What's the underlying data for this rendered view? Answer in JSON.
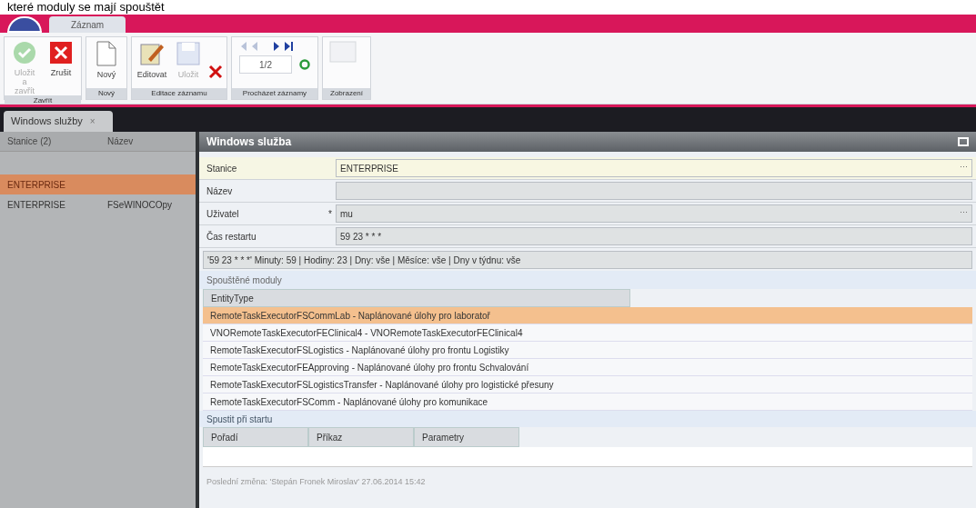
{
  "caption": "které moduly se mají spouštět",
  "ribbon": {
    "tabs": [
      {
        "label": "Záznam",
        "selected": true
      }
    ],
    "groups": [
      {
        "label": "Zavřít",
        "buttons": [
          {
            "kind": "ok",
            "label": "Uložit a zavřít",
            "disabled": true
          },
          {
            "kind": "cancel",
            "label": "Zrušit",
            "disabled": false
          }
        ]
      },
      {
        "label": "Nový",
        "buttons": [
          {
            "kind": "new",
            "label": "Nový",
            "disabled": false
          }
        ]
      },
      {
        "label": "Editace záznamu",
        "buttons": [
          {
            "kind": "edit",
            "label": "Editovat",
            "disabled": false
          },
          {
            "kind": "save",
            "label": "Uložit",
            "disabled": true
          },
          {
            "kind": "delete",
            "disabled": false
          }
        ]
      },
      {
        "label": "Procházet záznamy",
        "buttons": [
          {
            "kind": "pager",
            "label": "1/2",
            "disabled": false
          }
        ]
      },
      {
        "label": "Zobrazení",
        "buttons": [
          {
            "kind": "view",
            "disabled": true
          }
        ]
      }
    ]
  },
  "doc_tab": {
    "label": "Windows služby",
    "close": "×"
  },
  "list": {
    "columns": [
      "Stanice (2)",
      "Název"
    ],
    "rows": [
      {
        "cells": [
          "ENTERPRISE",
          ""
        ],
        "selected": true
      },
      {
        "cells": [
          "ENTERPRISE",
          "FSeWINOCOpy"
        ],
        "selected": false
      }
    ]
  },
  "dialog": {
    "title": "Windows služba",
    "fields": [
      {
        "label": "Stanice",
        "value": "ENTERPRISE",
        "focused": true,
        "button": "⋯"
      },
      {
        "label": "Název",
        "focused": false
      },
      {
        "label": "Uživatel",
        "required_mark": "*",
        "value": "mu",
        "focused": false,
        "button": "⋯"
      },
      {
        "label": "Čas restartu",
        "value": "59 23 * * *",
        "focused": false
      }
    ],
    "summary": "'59 23 * * *' Minuty: 59 | Hodiny: 23 | Dny: vše | Měsíce: vše | Dny v týdnu: vše",
    "modules": {
      "title": "Spouštěné moduly",
      "column": "EntityType",
      "rows": [
        {
          "text": "RemoteTaskExecutorFSCommLab - Naplánované úlohy pro laboratoř",
          "selected": true
        },
        {
          "text": "VNORemoteTaskExecutorFEClinical4 - VNORemoteTaskExecutorFEClinical4",
          "selected": false
        },
        {
          "text": "RemoteTaskExecutorFSLogistics - Naplánované úlohy pro frontu Logistiky",
          "selected": false
        },
        {
          "text": "RemoteTaskExecutorFEApproving - Naplánované úlohy pro frontu Schvalování",
          "selected": false
        },
        {
          "text": "RemoteTaskExecutorFSLogisticsTransfer - Naplánované úlohy pro logistické přesuny",
          "selected": false
        },
        {
          "text": "RemoteTaskExecutorFSComm - Naplánované úlohy pro komunikace",
          "selected": false
        }
      ]
    },
    "startup": {
      "title": "Spustit při startu",
      "columns": [
        "Pořadí",
        "Příkaz",
        "Parametry"
      ]
    },
    "footer": "Poslední změna: 'Stepán Fronek Miroslav' 27.06.2014 15:42"
  }
}
